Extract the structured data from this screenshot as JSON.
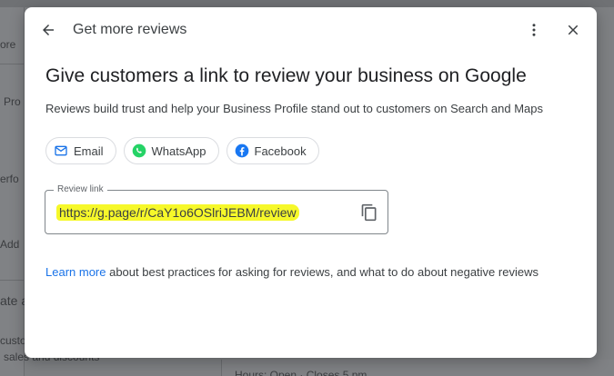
{
  "background": {
    "fragments": [
      "ore",
      "Pro",
      "erfo",
      "Add",
      "ate a",
      "custo",
      "sales and discounts",
      "Hours: Open · Closes 5 pm"
    ]
  },
  "dialog": {
    "title": "Get more reviews",
    "heading": "Give customers a link to review your business on Google",
    "subtext": "Reviews build trust and help your Business Profile stand out to customers on Search and Maps",
    "share_options": [
      {
        "label": "Email",
        "icon": "mail-icon",
        "color": "#1a73e8"
      },
      {
        "label": "WhatsApp",
        "icon": "whatsapp-icon",
        "color": "#25d366"
      },
      {
        "label": "Facebook",
        "icon": "facebook-icon",
        "color": "#1877f2"
      }
    ],
    "review_link": {
      "label": "Review link",
      "value": "https://g.page/r/CaY1o6OSlriJEBM/review"
    },
    "footer": {
      "link_text": "Learn more",
      "text": " about best practices for asking for reviews, and what to do about negative reviews"
    }
  },
  "colors": {
    "accent": "#1a73e8",
    "highlight": "#f6f82a"
  }
}
